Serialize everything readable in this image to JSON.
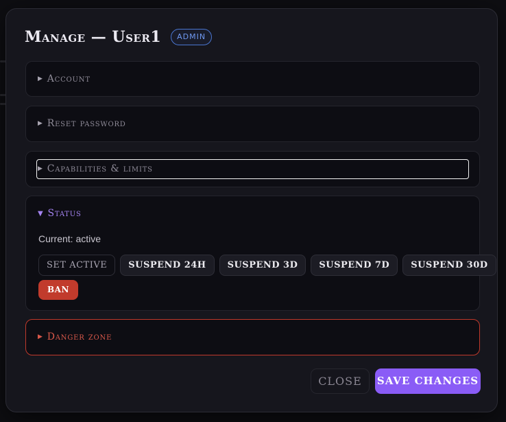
{
  "modal": {
    "title": "Manage — User1",
    "role_badge": "ADMIN"
  },
  "sections": {
    "account": {
      "label": "Account",
      "expanded": false
    },
    "reset_password": {
      "label": "Reset password",
      "expanded": false
    },
    "capabilities": {
      "label": "Capabilities & limits",
      "expanded": false,
      "focused": true
    },
    "status": {
      "label": "Status",
      "expanded": true,
      "current_text": "Current: active",
      "buttons": {
        "set_active": "SET ACTIVE",
        "suspend_24h": "SUSPEND 24H",
        "suspend_3d": "SUSPEND 3D",
        "suspend_7d": "SUSPEND 7D",
        "suspend_30d": "SUSPEND 30D",
        "ban": "BAN"
      }
    },
    "danger_zone": {
      "label": "Danger zone",
      "expanded": false
    }
  },
  "footer": {
    "close_label": "CLOSE",
    "save_label": "SAVE CHANGES"
  },
  "icons": {
    "collapsed": "caret-right-icon",
    "expanded": "caret-down-icon"
  },
  "colors": {
    "accent": "#8a5cf6",
    "accent_text": "#a584f2",
    "danger": "#c13b2c",
    "badge": "#4a76d1",
    "modal_bg": "#16161d",
    "section_bg": "#0d0d13"
  }
}
